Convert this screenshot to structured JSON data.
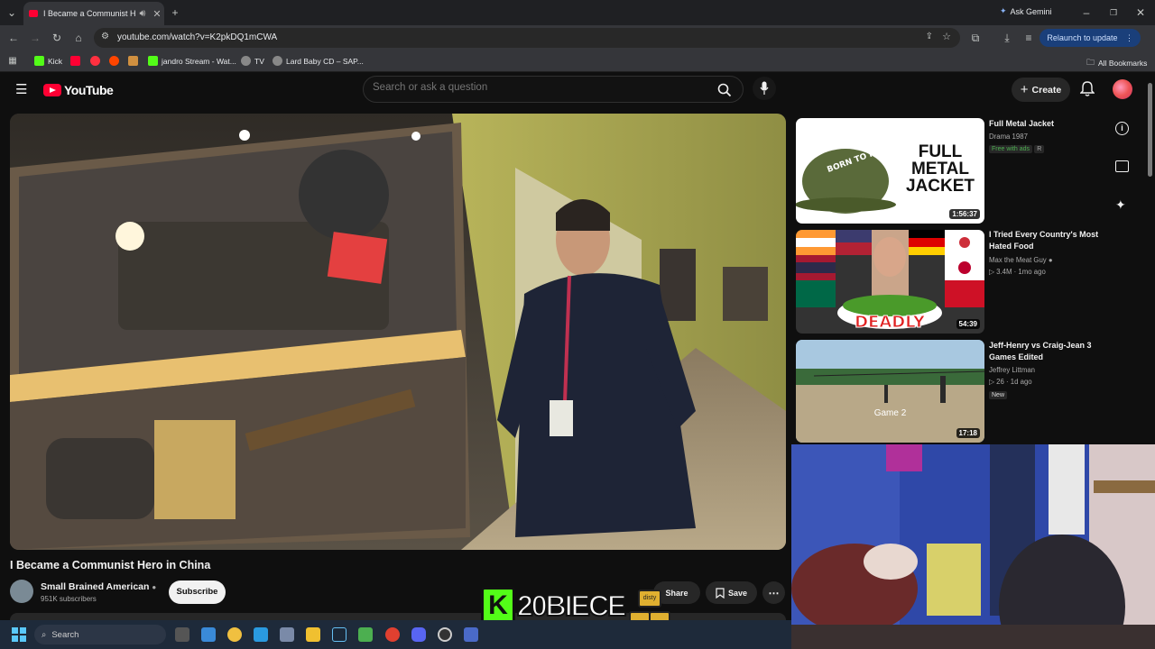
{
  "browser": {
    "tab_title": "I Became a Communist Hero in China",
    "url": "youtube.com/watch?v=K2pkDQ1mCWA",
    "ask_gemini": "Ask Gemini",
    "relaunch": "Relaunch to update",
    "bookmarks": [
      "Kick",
      "jandro Stream - Wat...",
      "TV",
      "Lard Baby CD – SAP..."
    ],
    "all_bookmarks": "All Bookmarks"
  },
  "youtube": {
    "logo_text": "YouTube",
    "search_placeholder": "Search or ask a question",
    "create_label": "Create"
  },
  "video": {
    "title": "I Became a Communist Hero in China",
    "channel": "Small Brained American",
    "subscribers": "951K subscribers",
    "subscribe_label": "Subscribe",
    "share_label": "Share",
    "save_label": "Save"
  },
  "recommendations": [
    {
      "title": "Full Metal Jacket",
      "line1": "Drama 1987",
      "badge1": "Free with ads",
      "badge2": "R",
      "duration": "1:56:37",
      "thumb_text": "FULL METAL JACKET",
      "helmet_text": "BORN TO KILL"
    },
    {
      "title": "I Tried Every Country's Most Hated Food",
      "line1": "Max the Meat Guy",
      "line2": "3.4M · 1mo ago",
      "duration": "54:39",
      "thumb_text": "DEADLY"
    },
    {
      "title": "Jeff-Henry vs Craig-Jean 3 Games Edited",
      "line1": "Jeffrey Littman",
      "line2": "26 · 1d ago",
      "badge1": "New",
      "duration": "17:18",
      "thumb_text": "Game 2"
    }
  ],
  "overlay": {
    "kick_username": "20BIECE",
    "can_label": "disty"
  },
  "taskbar": {
    "search_label": "Search"
  },
  "colors": {
    "yt_red": "#ff0033",
    "kick_green": "#53fc18",
    "background": "#0f0f0f"
  }
}
